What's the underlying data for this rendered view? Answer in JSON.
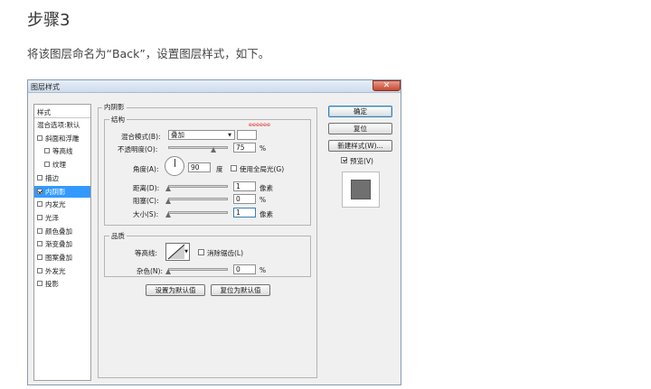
{
  "article": {
    "step_title": "步骤3",
    "instruction": "将该图层命名为“Back”，设置图层样式，如下。"
  },
  "dialog": {
    "title": "图层样式",
    "close_glyph": "✕",
    "styles_header": "样式",
    "style_items": [
      {
        "label": "混合选项:默认",
        "checkbox": false,
        "checked": false,
        "indent": 0
      },
      {
        "label": "斜面和浮雕",
        "checkbox": true,
        "checked": false,
        "indent": 0
      },
      {
        "label": "等高线",
        "checkbox": true,
        "checked": false,
        "indent": 1
      },
      {
        "label": "纹理",
        "checkbox": true,
        "checked": false,
        "indent": 1
      },
      {
        "label": "描边",
        "checkbox": true,
        "checked": false,
        "indent": 0
      },
      {
        "label": "内阴影",
        "checkbox": true,
        "checked": true,
        "indent": 0,
        "selected": true
      },
      {
        "label": "内发光",
        "checkbox": true,
        "checked": false,
        "indent": 0
      },
      {
        "label": "光泽",
        "checkbox": true,
        "checked": false,
        "indent": 0
      },
      {
        "label": "颜色叠加",
        "checkbox": true,
        "checked": false,
        "indent": 0
      },
      {
        "label": "渐变叠加",
        "checkbox": true,
        "checked": false,
        "indent": 0
      },
      {
        "label": "图案叠加",
        "checkbox": true,
        "checked": false,
        "indent": 0
      },
      {
        "label": "外发光",
        "checkbox": true,
        "checked": false,
        "indent": 0
      },
      {
        "label": "投影",
        "checkbox": true,
        "checked": false,
        "indent": 0
      }
    ],
    "inner_shadow": {
      "section_title": "内阴影",
      "structure": {
        "title": "结构",
        "blend_mode_label": "混合模式(B):",
        "blend_mode_value": "叠加",
        "color_hex_label": "eeeeee",
        "color_swatch": "#ffffff",
        "opacity_label": "不透明度(O):",
        "opacity_value": "75",
        "opacity_unit": "%",
        "opacity_fraction": 0.75,
        "angle_label": "角度(A):",
        "angle_value": "90",
        "angle_unit": "度",
        "global_light_label": "使用全局光(G)",
        "global_light_checked": false,
        "distance_label": "距离(D):",
        "distance_value": "1",
        "distance_unit": "像素",
        "choke_label": "阻塞(C):",
        "choke_value": "0",
        "choke_unit": "%",
        "size_label": "大小(S):",
        "size_value": "1",
        "size_unit": "像素"
      },
      "quality": {
        "title": "品质",
        "contour_label": "等高线:",
        "antialias_label": "消除锯齿(L)",
        "antialias_checked": false,
        "noise_label": "杂色(N):",
        "noise_value": "0",
        "noise_unit": "%"
      },
      "make_default_label": "设置为默认值",
      "reset_default_label": "复位为默认值"
    },
    "buttons": {
      "ok": "确定",
      "cancel": "复位",
      "new_style": "新建样式(W)...",
      "preview_label": "预览(V)",
      "preview_checked": true
    },
    "colors": {
      "selection": "#3399ff",
      "hex_text": "#e03030",
      "preview_fill": "#707070"
    }
  }
}
